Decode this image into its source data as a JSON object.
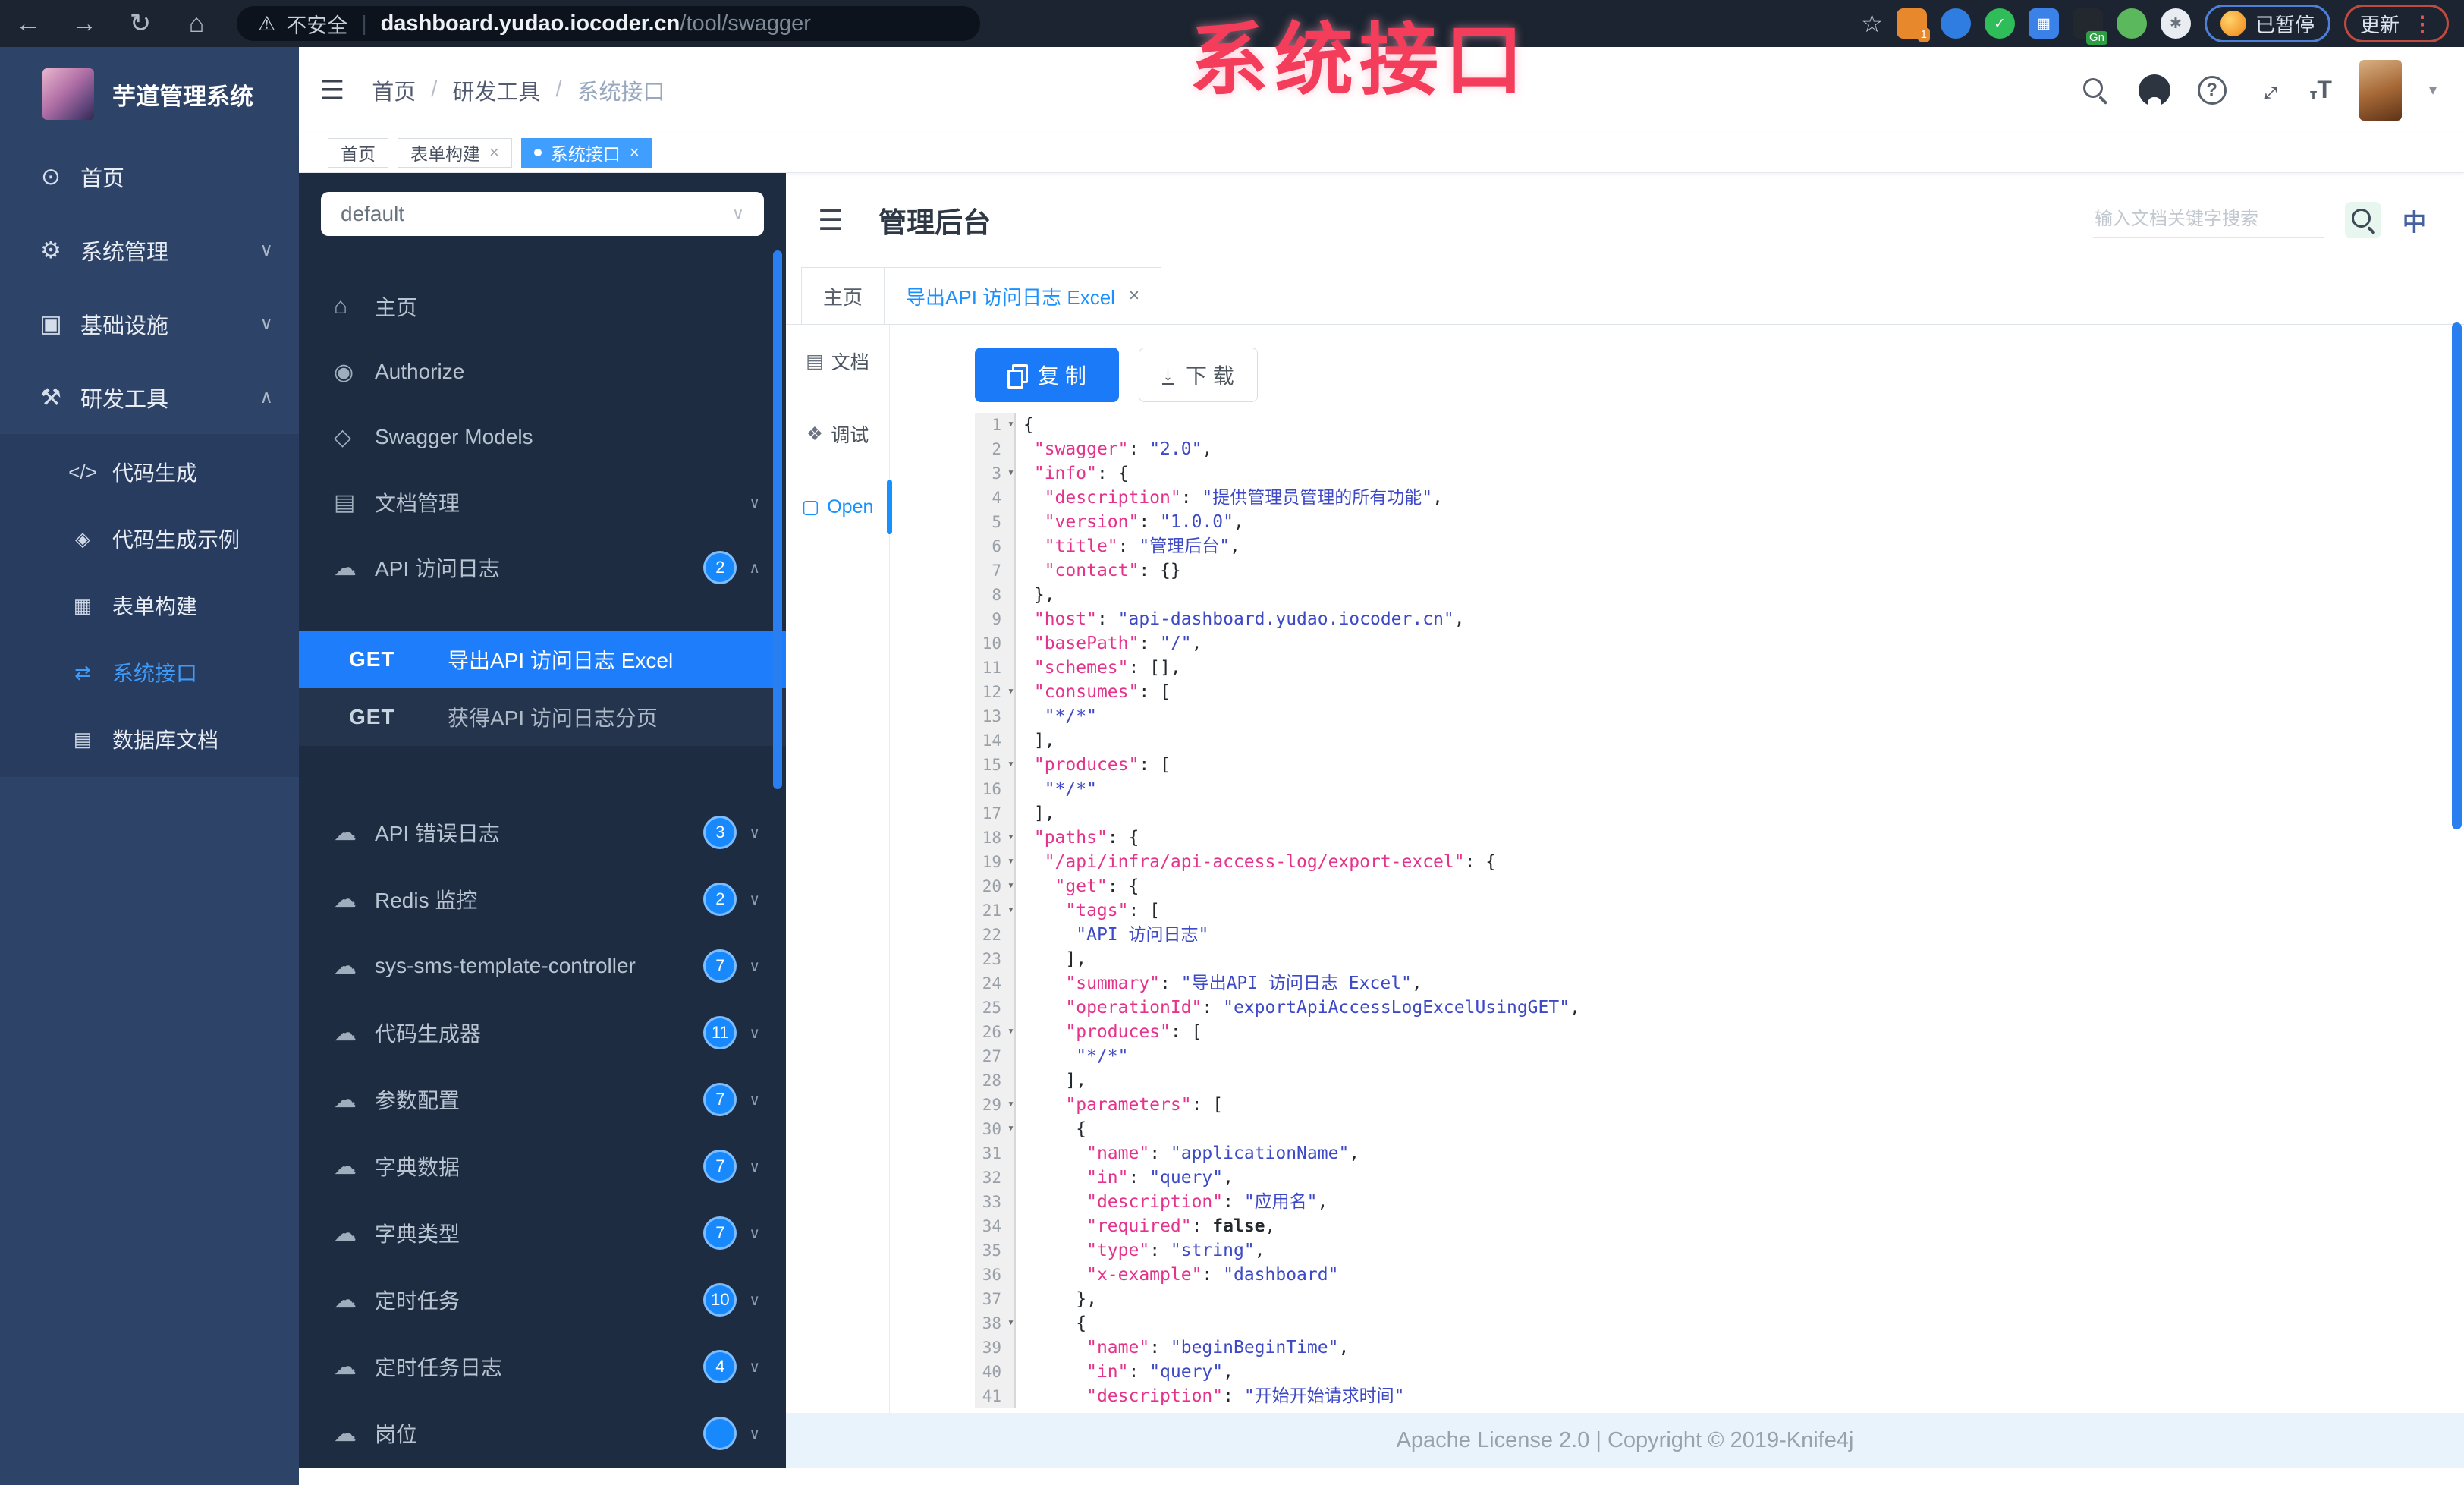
{
  "browser": {
    "security_label": "不安全",
    "url_domain": "dashboard.yudao.iocoder.cn",
    "url_path": "/tool/swagger",
    "extension_gn_label": "Gn",
    "extension_badge": "1",
    "paused_badge_label": "已暂停",
    "update_button_label": "更新"
  },
  "watermark": "系统接口",
  "sidebar": {
    "logo_title": "芋道管理系统",
    "items": [
      {
        "label": "首页",
        "icon": "dashboard-icon",
        "glyph": "⊙",
        "chevron": ""
      },
      {
        "label": "系统管理",
        "icon": "gear-icon",
        "glyph": "⚙",
        "chevron": "down"
      },
      {
        "label": "基础设施",
        "icon": "monitor-icon",
        "glyph": "▣",
        "chevron": "down"
      },
      {
        "label": "研发工具",
        "icon": "toolbox-icon",
        "glyph": "⚒",
        "chevron": "up",
        "expanded": true
      }
    ],
    "sub_items": [
      {
        "label": "代码生成",
        "icon": "code-icon",
        "glyph": "</>",
        "active": false
      },
      {
        "label": "代码生成示例",
        "icon": "shield-check-icon",
        "glyph": "◈",
        "active": false
      },
      {
        "label": "表单构建",
        "icon": "form-icon",
        "glyph": "▦",
        "active": false
      },
      {
        "label": "系统接口",
        "icon": "api-icon",
        "glyph": "⇄",
        "active": true
      },
      {
        "label": "数据库文档",
        "icon": "database-icon",
        "glyph": "▤",
        "active": false
      }
    ]
  },
  "topbar": {
    "breadcrumb": [
      "首页",
      "研发工具",
      "系统接口"
    ]
  },
  "tags": [
    {
      "label": "首页",
      "closable": false,
      "active": false
    },
    {
      "label": "表单构建",
      "closable": true,
      "active": false
    },
    {
      "label": "系统接口",
      "closable": true,
      "active": true
    }
  ],
  "swagger_panel": {
    "group_select_value": "default",
    "menu": [
      {
        "label": "主页",
        "icon": "home-icon",
        "glyph": "⌂",
        "badge": null,
        "chevron": ""
      },
      {
        "label": "Authorize",
        "icon": "lock-icon",
        "glyph": "◉",
        "badge": null,
        "chevron": ""
      },
      {
        "label": "Swagger Models",
        "icon": "models-icon",
        "glyph": "◇",
        "badge": null,
        "chevron": ""
      },
      {
        "label": "文档管理",
        "icon": "doc-manage-icon",
        "glyph": "▤",
        "badge": null,
        "chevron": "down"
      },
      {
        "label": "API 访问日志",
        "icon": "cloud-icon",
        "glyph": "☁",
        "badge": "2",
        "chevron": "up"
      }
    ],
    "operations": [
      {
        "method": "GET",
        "label": "导出API 访问日志 Excel",
        "selected": true
      },
      {
        "method": "GET",
        "label": "获得API 访问日志分页",
        "selected": false
      }
    ],
    "controllers": [
      {
        "label": "API 错误日志",
        "icon": "cloud-icon",
        "glyph": "☁",
        "badge": "3"
      },
      {
        "label": "Redis 监控",
        "icon": "cloud-icon",
        "glyph": "☁",
        "badge": "2"
      },
      {
        "label": "sys-sms-template-controller",
        "icon": "cloud-icon",
        "glyph": "☁",
        "badge": "7"
      },
      {
        "label": "代码生成器",
        "icon": "cloud-icon",
        "glyph": "☁",
        "badge": "11"
      },
      {
        "label": "参数配置",
        "icon": "cloud-icon",
        "glyph": "☁",
        "badge": "7"
      },
      {
        "label": "字典数据",
        "icon": "cloud-icon",
        "glyph": "☁",
        "badge": "7"
      },
      {
        "label": "字典类型",
        "icon": "cloud-icon",
        "glyph": "☁",
        "badge": "7"
      },
      {
        "label": "定时任务",
        "icon": "cloud-icon",
        "glyph": "☁",
        "badge": "10"
      },
      {
        "label": "定时任务日志",
        "icon": "cloud-icon",
        "glyph": "☁",
        "badge": "4"
      },
      {
        "label": "岗位",
        "icon": "cloud-icon",
        "glyph": "☁",
        "badge": ""
      }
    ]
  },
  "doc": {
    "title": "管理后台",
    "search_placeholder": "输入文档关键字搜索",
    "lang_toggle_label": "中",
    "tabs": [
      {
        "label": "主页",
        "closable": false,
        "active": false
      },
      {
        "label": "导出API 访问日志 Excel",
        "closable": true,
        "active": true
      }
    ],
    "side_tabs": [
      {
        "label": "文档",
        "icon": "doc-tab-icon",
        "glyph": "▤",
        "active": false
      },
      {
        "label": "调试",
        "icon": "debug-tab-icon",
        "glyph": "❖",
        "active": false
      },
      {
        "label": "Open",
        "icon": "open-tab-icon",
        "glyph": "▢",
        "active": true
      }
    ],
    "copy_button": "复 制",
    "download_button": "下 载"
  },
  "editor": {
    "lines": [
      {
        "n": 1,
        "f": true,
        "t": [
          [
            "pl",
            "{"
          ]
        ]
      },
      {
        "n": 2,
        "f": false,
        "t": [
          [
            "pl",
            " "
          ],
          [
            "key",
            "\"swagger\""
          ],
          [
            "pl",
            ": "
          ],
          [
            "str",
            "\"2.0\""
          ],
          [
            "pl",
            ","
          ]
        ]
      },
      {
        "n": 3,
        "f": true,
        "t": [
          [
            "pl",
            " "
          ],
          [
            "key",
            "\"info\""
          ],
          [
            "pl",
            ": {"
          ]
        ]
      },
      {
        "n": 4,
        "f": false,
        "t": [
          [
            "pl",
            "  "
          ],
          [
            "key",
            "\"description\""
          ],
          [
            "pl",
            ": "
          ],
          [
            "str",
            "\"提供管理员管理的所有功能\""
          ],
          [
            "pl",
            ","
          ]
        ]
      },
      {
        "n": 5,
        "f": false,
        "t": [
          [
            "pl",
            "  "
          ],
          [
            "key",
            "\"version\""
          ],
          [
            "pl",
            ": "
          ],
          [
            "str",
            "\"1.0.0\""
          ],
          [
            "pl",
            ","
          ]
        ]
      },
      {
        "n": 6,
        "f": false,
        "t": [
          [
            "pl",
            "  "
          ],
          [
            "key",
            "\"title\""
          ],
          [
            "pl",
            ": "
          ],
          [
            "str",
            "\"管理后台\""
          ],
          [
            "pl",
            ","
          ]
        ]
      },
      {
        "n": 7,
        "f": false,
        "t": [
          [
            "pl",
            "  "
          ],
          [
            "key",
            "\"contact\""
          ],
          [
            "pl",
            ": {}"
          ]
        ]
      },
      {
        "n": 8,
        "f": false,
        "t": [
          [
            "pl",
            " },"
          ]
        ]
      },
      {
        "n": 9,
        "f": false,
        "t": [
          [
            "pl",
            " "
          ],
          [
            "key",
            "\"host\""
          ],
          [
            "pl",
            ": "
          ],
          [
            "str",
            "\"api-dashboard.yudao.iocoder.cn\""
          ],
          [
            "pl",
            ","
          ]
        ]
      },
      {
        "n": 10,
        "f": false,
        "t": [
          [
            "pl",
            " "
          ],
          [
            "key",
            "\"basePath\""
          ],
          [
            "pl",
            ": "
          ],
          [
            "str",
            "\"/\""
          ],
          [
            "pl",
            ","
          ]
        ]
      },
      {
        "n": 11,
        "f": false,
        "t": [
          [
            "pl",
            " "
          ],
          [
            "key",
            "\"schemes\""
          ],
          [
            "pl",
            ": [],"
          ]
        ]
      },
      {
        "n": 12,
        "f": true,
        "t": [
          [
            "pl",
            " "
          ],
          [
            "key",
            "\"consumes\""
          ],
          [
            "pl",
            ": ["
          ]
        ]
      },
      {
        "n": 13,
        "f": false,
        "t": [
          [
            "pl",
            "  "
          ],
          [
            "str",
            "\"*/*\""
          ]
        ]
      },
      {
        "n": 14,
        "f": false,
        "t": [
          [
            "pl",
            " ],"
          ]
        ]
      },
      {
        "n": 15,
        "f": true,
        "t": [
          [
            "pl",
            " "
          ],
          [
            "key",
            "\"produces\""
          ],
          [
            "pl",
            ": ["
          ]
        ]
      },
      {
        "n": 16,
        "f": false,
        "t": [
          [
            "pl",
            "  "
          ],
          [
            "str",
            "\"*/*\""
          ]
        ]
      },
      {
        "n": 17,
        "f": false,
        "t": [
          [
            "pl",
            " ],"
          ]
        ]
      },
      {
        "n": 18,
        "f": true,
        "t": [
          [
            "pl",
            " "
          ],
          [
            "key",
            "\"paths\""
          ],
          [
            "pl",
            ": {"
          ]
        ]
      },
      {
        "n": 19,
        "f": true,
        "t": [
          [
            "pl",
            "  "
          ],
          [
            "key",
            "\"/api/infra/api-access-log/export-excel\""
          ],
          [
            "pl",
            ": {"
          ]
        ]
      },
      {
        "n": 20,
        "f": true,
        "t": [
          [
            "pl",
            "   "
          ],
          [
            "key",
            "\"get\""
          ],
          [
            "pl",
            ": {"
          ]
        ]
      },
      {
        "n": 21,
        "f": true,
        "t": [
          [
            "pl",
            "    "
          ],
          [
            "key",
            "\"tags\""
          ],
          [
            "pl",
            ": ["
          ]
        ]
      },
      {
        "n": 22,
        "f": false,
        "t": [
          [
            "pl",
            "     "
          ],
          [
            "str",
            "\"API 访问日志\""
          ]
        ]
      },
      {
        "n": 23,
        "f": false,
        "t": [
          [
            "pl",
            "    ],"
          ]
        ]
      },
      {
        "n": 24,
        "f": false,
        "t": [
          [
            "pl",
            "    "
          ],
          [
            "key",
            "\"summary\""
          ],
          [
            "pl",
            ": "
          ],
          [
            "str",
            "\"导出API 访问日志 Excel\""
          ],
          [
            "pl",
            ","
          ]
        ]
      },
      {
        "n": 25,
        "f": false,
        "t": [
          [
            "pl",
            "    "
          ],
          [
            "key",
            "\"operationId\""
          ],
          [
            "pl",
            ": "
          ],
          [
            "str",
            "\"exportApiAccessLogExcelUsingGET\""
          ],
          [
            "pl",
            ","
          ]
        ]
      },
      {
        "n": 26,
        "f": true,
        "t": [
          [
            "pl",
            "    "
          ],
          [
            "key",
            "\"produces\""
          ],
          [
            "pl",
            ": ["
          ]
        ]
      },
      {
        "n": 27,
        "f": false,
        "t": [
          [
            "pl",
            "     "
          ],
          [
            "str",
            "\"*/*\""
          ]
        ]
      },
      {
        "n": 28,
        "f": false,
        "t": [
          [
            "pl",
            "    ],"
          ]
        ]
      },
      {
        "n": 29,
        "f": true,
        "t": [
          [
            "pl",
            "    "
          ],
          [
            "key",
            "\"parameters\""
          ],
          [
            "pl",
            ": ["
          ]
        ]
      },
      {
        "n": 30,
        "f": true,
        "t": [
          [
            "pl",
            "     {"
          ]
        ]
      },
      {
        "n": 31,
        "f": false,
        "t": [
          [
            "pl",
            "      "
          ],
          [
            "key",
            "\"name\""
          ],
          [
            "pl",
            ": "
          ],
          [
            "str",
            "\"applicationName\""
          ],
          [
            "pl",
            ","
          ]
        ]
      },
      {
        "n": 32,
        "f": false,
        "t": [
          [
            "pl",
            "      "
          ],
          [
            "key",
            "\"in\""
          ],
          [
            "pl",
            ": "
          ],
          [
            "str",
            "\"query\""
          ],
          [
            "pl",
            ","
          ]
        ]
      },
      {
        "n": 33,
        "f": false,
        "t": [
          [
            "pl",
            "      "
          ],
          [
            "key",
            "\"description\""
          ],
          [
            "pl",
            ": "
          ],
          [
            "str",
            "\"应用名\""
          ],
          [
            "pl",
            ","
          ]
        ]
      },
      {
        "n": 34,
        "f": false,
        "t": [
          [
            "pl",
            "      "
          ],
          [
            "key",
            "\"required\""
          ],
          [
            "pl",
            ": "
          ],
          [
            "kw",
            "false"
          ],
          [
            "pl",
            ","
          ]
        ]
      },
      {
        "n": 35,
        "f": false,
        "t": [
          [
            "pl",
            "      "
          ],
          [
            "key",
            "\"type\""
          ],
          [
            "pl",
            ": "
          ],
          [
            "str",
            "\"string\""
          ],
          [
            "pl",
            ","
          ]
        ]
      },
      {
        "n": 36,
        "f": false,
        "t": [
          [
            "pl",
            "      "
          ],
          [
            "key",
            "\"x-example\""
          ],
          [
            "pl",
            ": "
          ],
          [
            "str",
            "\"dashboard\""
          ]
        ]
      },
      {
        "n": 37,
        "f": false,
        "t": [
          [
            "pl",
            "     },"
          ]
        ]
      },
      {
        "n": 38,
        "f": true,
        "t": [
          [
            "pl",
            "     {"
          ]
        ]
      },
      {
        "n": 39,
        "f": false,
        "t": [
          [
            "pl",
            "      "
          ],
          [
            "key",
            "\"name\""
          ],
          [
            "pl",
            ": "
          ],
          [
            "str",
            "\"beginBeginTime\""
          ],
          [
            "pl",
            ","
          ]
        ]
      },
      {
        "n": 40,
        "f": false,
        "t": [
          [
            "pl",
            "      "
          ],
          [
            "key",
            "\"in\""
          ],
          [
            "pl",
            ": "
          ],
          [
            "str",
            "\"query\""
          ],
          [
            "pl",
            ","
          ]
        ]
      },
      {
        "n": 41,
        "f": false,
        "t": [
          [
            "pl",
            "      "
          ],
          [
            "key",
            "\"description\""
          ],
          [
            "pl",
            ": "
          ],
          [
            "str",
            "\"开始开始请求时间\""
          ]
        ]
      }
    ]
  },
  "footer": {
    "text": "Apache License 2.0 | Copyright © 2019-Knife4j"
  }
}
